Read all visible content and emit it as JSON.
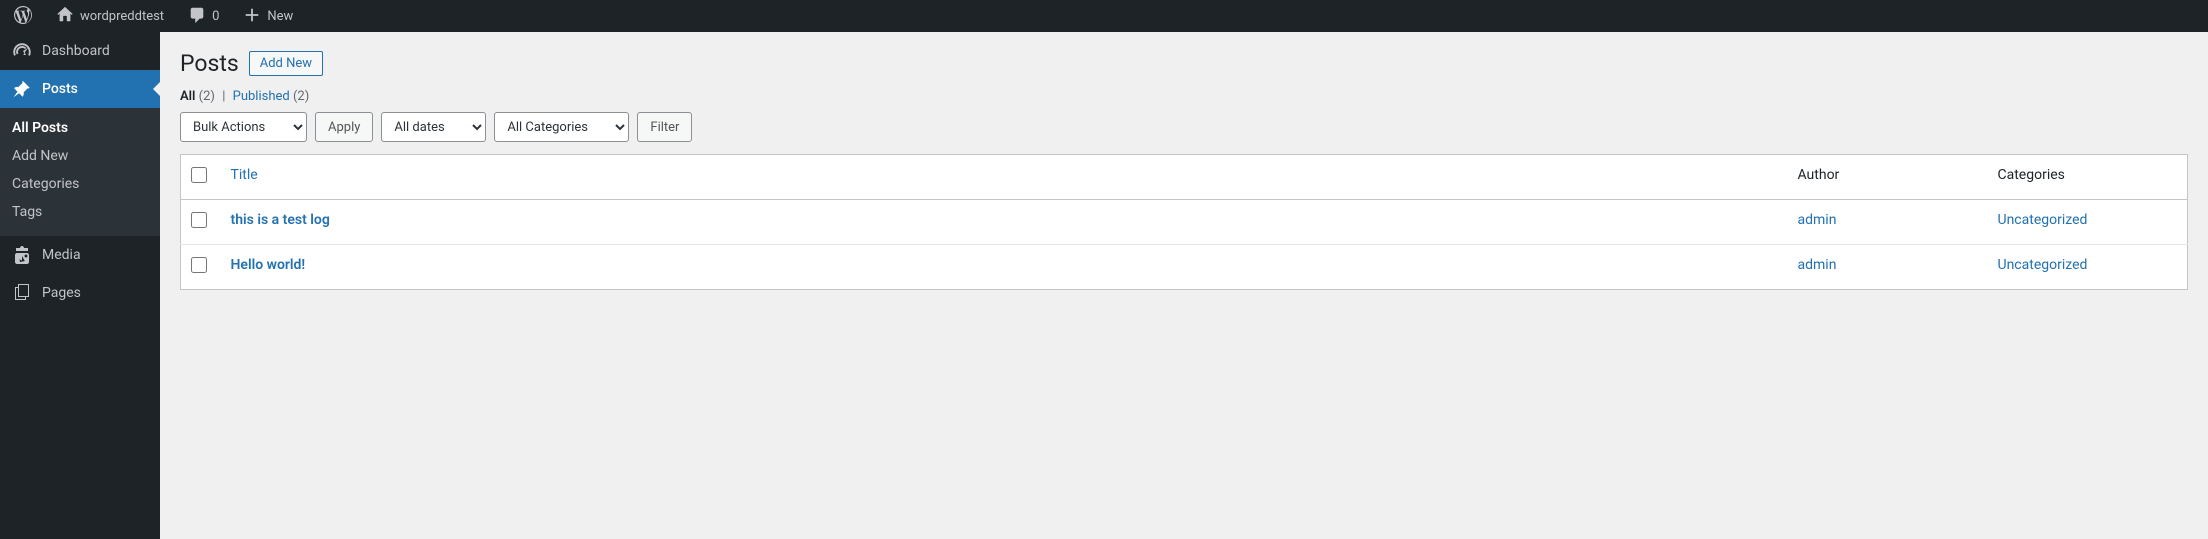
{
  "adminbar": {
    "site_name": "wordpreddtest",
    "comment_count": "0",
    "new_label": "New"
  },
  "sidebar": {
    "items": [
      {
        "id": "dashboard",
        "label": "Dashboard"
      },
      {
        "id": "posts",
        "label": "Posts",
        "current": true,
        "submenu": [
          {
            "id": "all-posts",
            "label": "All Posts",
            "current": true
          },
          {
            "id": "add-new",
            "label": "Add New"
          },
          {
            "id": "categories",
            "label": "Categories"
          },
          {
            "id": "tags",
            "label": "Tags"
          }
        ]
      },
      {
        "id": "media",
        "label": "Media"
      },
      {
        "id": "pages",
        "label": "Pages"
      }
    ]
  },
  "page": {
    "title": "Posts",
    "add_new": "Add New"
  },
  "filters": {
    "all_label": "All",
    "all_count": "(2)",
    "published_label": "Published",
    "published_count": "(2)"
  },
  "tablenav": {
    "bulk_actions": "Bulk Actions",
    "apply": "Apply",
    "all_dates": "All dates",
    "all_categories": "All Categories",
    "filter": "Filter"
  },
  "table": {
    "columns": {
      "title": "Title",
      "author": "Author",
      "categories": "Categories"
    },
    "rows": [
      {
        "title": "this is a test log",
        "author": "admin",
        "categories": "Uncategorized"
      },
      {
        "title": "Hello world!",
        "author": "admin",
        "categories": "Uncategorized"
      }
    ]
  },
  "colors": {
    "accent": "#2271b1",
    "adminbar": "#1d2327"
  }
}
